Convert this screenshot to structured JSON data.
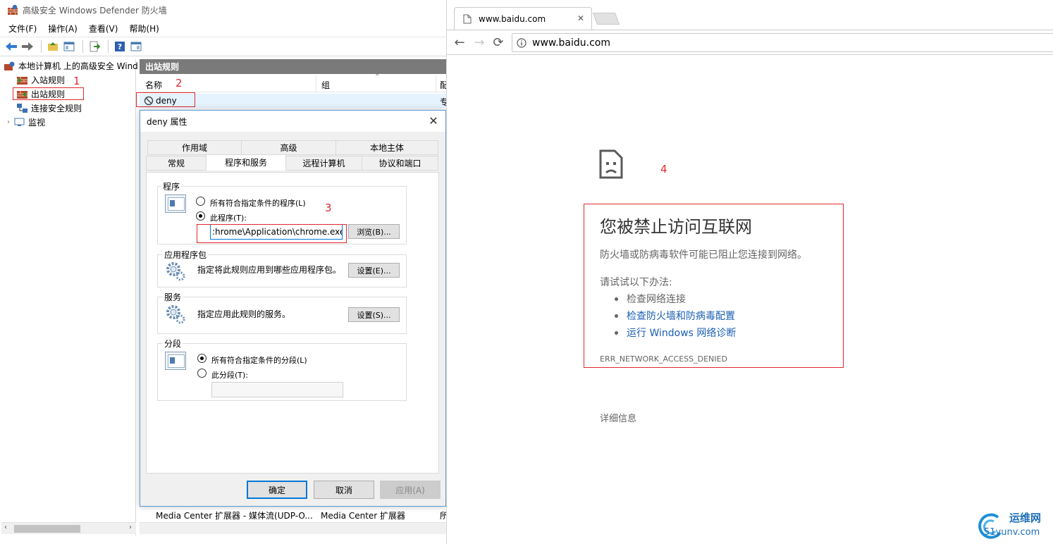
{
  "mmc": {
    "title": "高级安全 Windows Defender 防火墙",
    "menu": [
      "文件(F)",
      "操作(A)",
      "查看(V)",
      "帮助(H)"
    ],
    "tree": {
      "root": "本地计算机 上的高级安全 Wind",
      "inbound": "入站规则",
      "outbound": "出站规则",
      "connection": "连接安全规则",
      "monitor": "监视"
    },
    "list": {
      "header": "出站规则",
      "col_name": "名称",
      "col_group": "组",
      "col_extra": "配",
      "rows": [
        {
          "name": "deny",
          "extra": "专"
        },
        {
          "name": "Media Center 扩展器 - 媒体流(UDP-O...",
          "group": "Media Center 扩展器",
          "extra": "所"
        }
      ]
    }
  },
  "dialog": {
    "title": "deny 属性",
    "tabs_top": [
      "作用域",
      "高级",
      "本地主体"
    ],
    "tabs_bottom": [
      "常规",
      "程序和服务",
      "远程计算机",
      "协议和端口"
    ],
    "programs": {
      "label": "程序",
      "opt_all": "所有符合指定条件的程序(L)",
      "opt_this": "此程序(T):",
      "path": ":hrome\\Application\\chrome.exe",
      "browse": "浏览(B)..."
    },
    "packages": {
      "label": "应用程序包",
      "desc": "指定将此规则应用到哪些应用程序包。",
      "settings": "设置(E)..."
    },
    "services": {
      "label": "服务",
      "desc": "指定应用此规则的服务。",
      "settings": "设置(S)..."
    },
    "segments": {
      "label": "分段",
      "opt_all": "所有符合指定条件的分段(L)",
      "opt_this": "此分段(T):"
    },
    "ok": "确定",
    "cancel": "取消",
    "apply": "应用(A)"
  },
  "annotations": [
    "1",
    "2",
    "3",
    "4"
  ],
  "chrome": {
    "tab_title": "www.baidu.com",
    "url": "www.baidu.com",
    "error": {
      "title": "您被禁止访问互联网",
      "desc": "防火墙或防病毒软件可能已阻止您连接到网络。",
      "try": "请试试以下办法:",
      "suggestions": [
        "检查网络连接",
        "检查防火墙和防病毒配置",
        "运行 Windows 网络诊断"
      ],
      "code": "ERR_NETWORK_ACCESS_DENIED",
      "details": "详细信息"
    }
  },
  "watermark": {
    "line1": "运维网",
    "line2": "51yunv.com"
  },
  "colors": {
    "annotation_red": "#e0282e",
    "link_blue": "#1a5fb4",
    "dialog_accent": "#0078d7"
  }
}
